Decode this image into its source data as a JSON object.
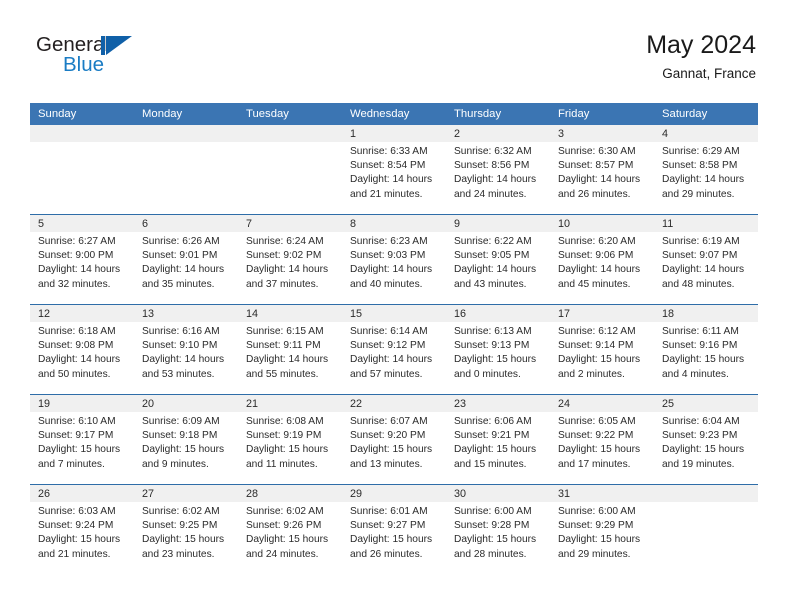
{
  "brand": {
    "name_part1": "General",
    "name_part2": "Blue",
    "accent_color": "#1060a8",
    "blue_text_color": "#1a7cc4"
  },
  "header": {
    "title": "May 2024",
    "location": "Gannat, France"
  },
  "colors": {
    "header_bar": "#3b75b3",
    "week_separator": "#2e6da8",
    "date_strip": "#f0f0f0"
  },
  "weekdays": [
    "Sunday",
    "Monday",
    "Tuesday",
    "Wednesday",
    "Thursday",
    "Friday",
    "Saturday"
  ],
  "weeks": [
    [
      {
        "day": "",
        "empty": true
      },
      {
        "day": "",
        "empty": true
      },
      {
        "day": "",
        "empty": true
      },
      {
        "day": "1",
        "sunrise": "Sunrise: 6:33 AM",
        "sunset": "Sunset: 8:54 PM",
        "daylight1": "Daylight: 14 hours",
        "daylight2": "and 21 minutes."
      },
      {
        "day": "2",
        "sunrise": "Sunrise: 6:32 AM",
        "sunset": "Sunset: 8:56 PM",
        "daylight1": "Daylight: 14 hours",
        "daylight2": "and 24 minutes."
      },
      {
        "day": "3",
        "sunrise": "Sunrise: 6:30 AM",
        "sunset": "Sunset: 8:57 PM",
        "daylight1": "Daylight: 14 hours",
        "daylight2": "and 26 minutes."
      },
      {
        "day": "4",
        "sunrise": "Sunrise: 6:29 AM",
        "sunset": "Sunset: 8:58 PM",
        "daylight1": "Daylight: 14 hours",
        "daylight2": "and 29 minutes."
      }
    ],
    [
      {
        "day": "5",
        "sunrise": "Sunrise: 6:27 AM",
        "sunset": "Sunset: 9:00 PM",
        "daylight1": "Daylight: 14 hours",
        "daylight2": "and 32 minutes."
      },
      {
        "day": "6",
        "sunrise": "Sunrise: 6:26 AM",
        "sunset": "Sunset: 9:01 PM",
        "daylight1": "Daylight: 14 hours",
        "daylight2": "and 35 minutes."
      },
      {
        "day": "7",
        "sunrise": "Sunrise: 6:24 AM",
        "sunset": "Sunset: 9:02 PM",
        "daylight1": "Daylight: 14 hours",
        "daylight2": "and 37 minutes."
      },
      {
        "day": "8",
        "sunrise": "Sunrise: 6:23 AM",
        "sunset": "Sunset: 9:03 PM",
        "daylight1": "Daylight: 14 hours",
        "daylight2": "and 40 minutes."
      },
      {
        "day": "9",
        "sunrise": "Sunrise: 6:22 AM",
        "sunset": "Sunset: 9:05 PM",
        "daylight1": "Daylight: 14 hours",
        "daylight2": "and 43 minutes."
      },
      {
        "day": "10",
        "sunrise": "Sunrise: 6:20 AM",
        "sunset": "Sunset: 9:06 PM",
        "daylight1": "Daylight: 14 hours",
        "daylight2": "and 45 minutes."
      },
      {
        "day": "11",
        "sunrise": "Sunrise: 6:19 AM",
        "sunset": "Sunset: 9:07 PM",
        "daylight1": "Daylight: 14 hours",
        "daylight2": "and 48 minutes."
      }
    ],
    [
      {
        "day": "12",
        "sunrise": "Sunrise: 6:18 AM",
        "sunset": "Sunset: 9:08 PM",
        "daylight1": "Daylight: 14 hours",
        "daylight2": "and 50 minutes."
      },
      {
        "day": "13",
        "sunrise": "Sunrise: 6:16 AM",
        "sunset": "Sunset: 9:10 PM",
        "daylight1": "Daylight: 14 hours",
        "daylight2": "and 53 minutes."
      },
      {
        "day": "14",
        "sunrise": "Sunrise: 6:15 AM",
        "sunset": "Sunset: 9:11 PM",
        "daylight1": "Daylight: 14 hours",
        "daylight2": "and 55 minutes."
      },
      {
        "day": "15",
        "sunrise": "Sunrise: 6:14 AM",
        "sunset": "Sunset: 9:12 PM",
        "daylight1": "Daylight: 14 hours",
        "daylight2": "and 57 minutes."
      },
      {
        "day": "16",
        "sunrise": "Sunrise: 6:13 AM",
        "sunset": "Sunset: 9:13 PM",
        "daylight1": "Daylight: 15 hours",
        "daylight2": "and 0 minutes."
      },
      {
        "day": "17",
        "sunrise": "Sunrise: 6:12 AM",
        "sunset": "Sunset: 9:14 PM",
        "daylight1": "Daylight: 15 hours",
        "daylight2": "and 2 minutes."
      },
      {
        "day": "18",
        "sunrise": "Sunrise: 6:11 AM",
        "sunset": "Sunset: 9:16 PM",
        "daylight1": "Daylight: 15 hours",
        "daylight2": "and 4 minutes."
      }
    ],
    [
      {
        "day": "19",
        "sunrise": "Sunrise: 6:10 AM",
        "sunset": "Sunset: 9:17 PM",
        "daylight1": "Daylight: 15 hours",
        "daylight2": "and 7 minutes."
      },
      {
        "day": "20",
        "sunrise": "Sunrise: 6:09 AM",
        "sunset": "Sunset: 9:18 PM",
        "daylight1": "Daylight: 15 hours",
        "daylight2": "and 9 minutes."
      },
      {
        "day": "21",
        "sunrise": "Sunrise: 6:08 AM",
        "sunset": "Sunset: 9:19 PM",
        "daylight1": "Daylight: 15 hours",
        "daylight2": "and 11 minutes."
      },
      {
        "day": "22",
        "sunrise": "Sunrise: 6:07 AM",
        "sunset": "Sunset: 9:20 PM",
        "daylight1": "Daylight: 15 hours",
        "daylight2": "and 13 minutes."
      },
      {
        "day": "23",
        "sunrise": "Sunrise: 6:06 AM",
        "sunset": "Sunset: 9:21 PM",
        "daylight1": "Daylight: 15 hours",
        "daylight2": "and 15 minutes."
      },
      {
        "day": "24",
        "sunrise": "Sunrise: 6:05 AM",
        "sunset": "Sunset: 9:22 PM",
        "daylight1": "Daylight: 15 hours",
        "daylight2": "and 17 minutes."
      },
      {
        "day": "25",
        "sunrise": "Sunrise: 6:04 AM",
        "sunset": "Sunset: 9:23 PM",
        "daylight1": "Daylight: 15 hours",
        "daylight2": "and 19 minutes."
      }
    ],
    [
      {
        "day": "26",
        "sunrise": "Sunrise: 6:03 AM",
        "sunset": "Sunset: 9:24 PM",
        "daylight1": "Daylight: 15 hours",
        "daylight2": "and 21 minutes."
      },
      {
        "day": "27",
        "sunrise": "Sunrise: 6:02 AM",
        "sunset": "Sunset: 9:25 PM",
        "daylight1": "Daylight: 15 hours",
        "daylight2": "and 23 minutes."
      },
      {
        "day": "28",
        "sunrise": "Sunrise: 6:02 AM",
        "sunset": "Sunset: 9:26 PM",
        "daylight1": "Daylight: 15 hours",
        "daylight2": "and 24 minutes."
      },
      {
        "day": "29",
        "sunrise": "Sunrise: 6:01 AM",
        "sunset": "Sunset: 9:27 PM",
        "daylight1": "Daylight: 15 hours",
        "daylight2": "and 26 minutes."
      },
      {
        "day": "30",
        "sunrise": "Sunrise: 6:00 AM",
        "sunset": "Sunset: 9:28 PM",
        "daylight1": "Daylight: 15 hours",
        "daylight2": "and 28 minutes."
      },
      {
        "day": "31",
        "sunrise": "Sunrise: 6:00 AM",
        "sunset": "Sunset: 9:29 PM",
        "daylight1": "Daylight: 15 hours",
        "daylight2": "and 29 minutes."
      },
      {
        "day": "",
        "empty": true
      }
    ]
  ]
}
